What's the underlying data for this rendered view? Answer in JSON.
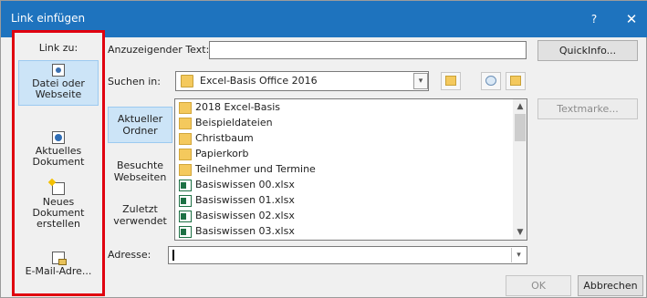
{
  "window": {
    "title": "Link einfügen",
    "help_label": "?",
    "close_label": "✕"
  },
  "link_to": {
    "heading": "Link zu:",
    "items": [
      {
        "line1": "Datei oder",
        "line2": "Webseite",
        "line3": "",
        "icon": "file-web-icon",
        "active": true
      },
      {
        "line1": "Aktuelles",
        "line2": "Dokument",
        "line3": "",
        "icon": "document-icon",
        "active": false
      },
      {
        "line1": "Neues",
        "line2": "Dokument",
        "line3": "erstellen",
        "icon": "new-document-icon",
        "active": false
      },
      {
        "line1": "E-Mail-Adre...",
        "line2": "",
        "line3": "",
        "icon": "email-icon",
        "active": false
      }
    ]
  },
  "display_text": {
    "label": "Anzuzeigender Text:",
    "value": ""
  },
  "quickinfo_button": "QuickInfo...",
  "search_in": {
    "label": "Suchen in:",
    "value": "Excel-Basis Office 2016"
  },
  "tools": [
    {
      "icon": "folder-up-icon"
    },
    {
      "icon": "browse-web-icon"
    },
    {
      "icon": "browse-file-icon"
    }
  ],
  "nav": [
    {
      "line1": "Aktueller",
      "line2": "Ordner",
      "active": true
    },
    {
      "line1": "Besuchte",
      "line2": "Webseiten",
      "active": false
    },
    {
      "line1": "Zuletzt",
      "line2": "verwendet",
      "active": false
    }
  ],
  "files": [
    {
      "name": "2018 Excel-Basis",
      "type": "folder"
    },
    {
      "name": "Beispieldateien",
      "type": "folder"
    },
    {
      "name": "Christbaum",
      "type": "folder"
    },
    {
      "name": "Papierkorb",
      "type": "folder"
    },
    {
      "name": "Teilnehmer und Termine",
      "type": "folder"
    },
    {
      "name": "Basiswissen 00.xlsx",
      "type": "excel"
    },
    {
      "name": "Basiswissen 01.xlsx",
      "type": "excel"
    },
    {
      "name": "Basiswissen 02.xlsx",
      "type": "excel"
    },
    {
      "name": "Basiswissen 03.xlsx",
      "type": "excel"
    }
  ],
  "textmarke_button": "Textmarke...",
  "address": {
    "label": "Adresse:",
    "value": ""
  },
  "ok_button": "OK",
  "cancel_button": "Abbrechen",
  "colors": {
    "titlebar": "#1e73be",
    "highlight_border": "#e0000f",
    "selection": "#cce4f7"
  }
}
